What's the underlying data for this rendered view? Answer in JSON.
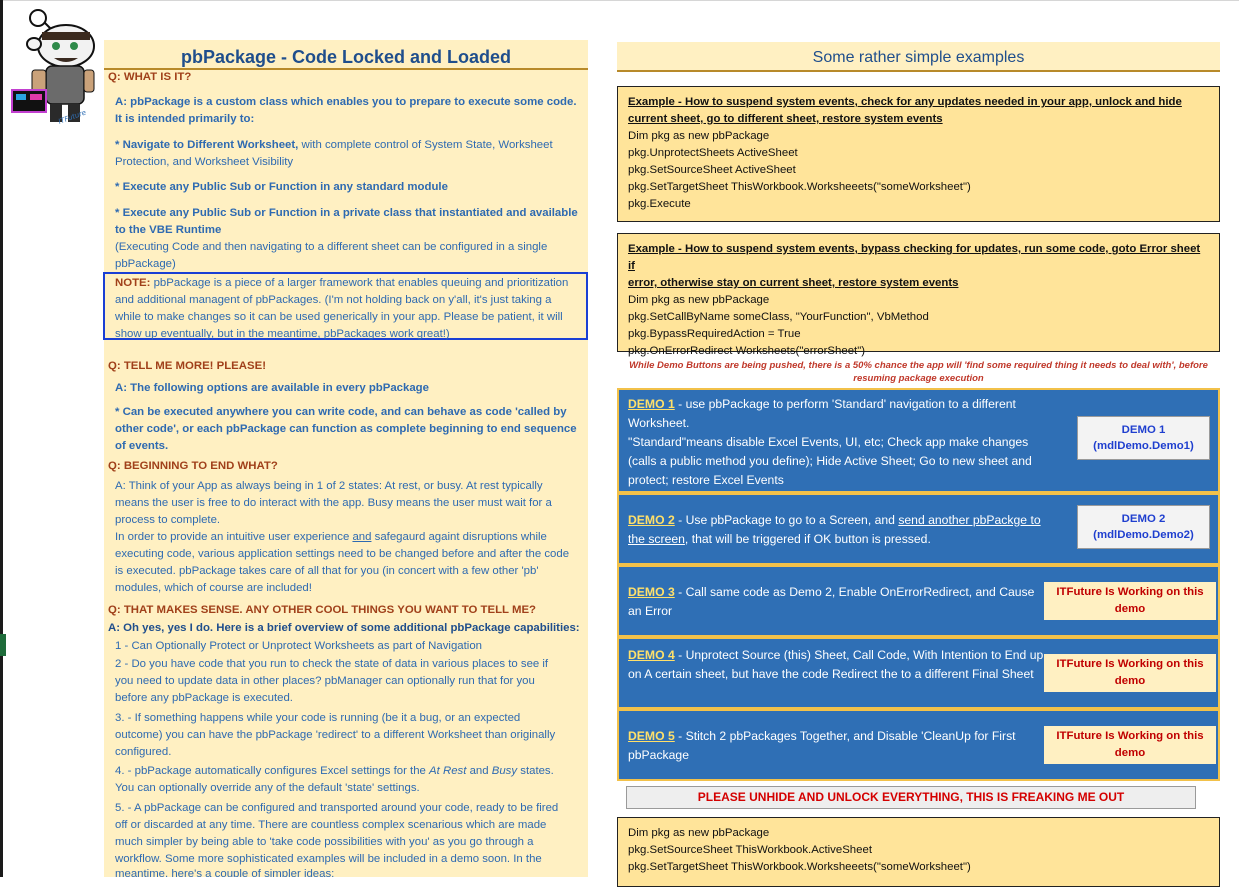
{
  "left": {
    "title": "pbPackage - Code Locked and Loaded",
    "q1": "Q: WHAT IS IT?",
    "a1_l1": "A: pbPackage is a custom class which enables you to  prepare to execute some code.",
    "a1_l2": "It is intended primarily to:",
    "nav_bold": "* Navigate to Different Worksheet,",
    "nav_rest": " with complete control of System State, Worksheet",
    "nav_l2": "Protection, and Worksheet Visibility",
    "exec_public": "* Execute any Public Sub or Function in any standard module",
    "exec_private_l1": "* Execute any Public Sub or Function in a private class that instantiated and available",
    "exec_private_l2": "to the VBE Runtime",
    "exec_note_l1": "(Executing Code and then navigating to a different sheet can be configured in a single",
    "exec_note_l2": "pbPackage)",
    "note_label": "NOTE:",
    "note_l1": " pbPackage is a piece of a larger framework that enables queuing and prioritization",
    "note_l2": "and additional managent of pbPackages. (I'm not holding back on y'all, it's just taking a",
    "note_l3": "while to make changes so it can be used generically in your app. Please be patient, it will",
    "note_l4": "show up eventually, but in the meantime, pbPackages work great!)",
    "q2": "Q: TELL ME MORE! PLEASE!",
    "a2_l1": "A: The following options are available in every pbPackage",
    "a2_b_l1": "* Can be executed anywhere you can write code, and can behave as code 'called by",
    "a2_b_l2": "other code', or each pbPackage can function as complete beginning to end sequence",
    "a2_b_l3": "of events.",
    "q3": "Q: BEGINNING TO END WHAT?",
    "a3_l1": "A: Think of your App as always being in 1 of 2 states:  At rest, or busy. At rest typically",
    "a3_l2": "means the user is free to do interact with the app.  Busy means the user must wait for a",
    "a3_l3": "process to complete.",
    "a3_l4a": "In order to provide an intuitive user experience ",
    "a3_l4u": "and",
    "a3_l4b": " safegaurd againt disruptions while",
    "a3_l5": "executing code, various application settings need to be changed before and after the code",
    "a3_l6": "is executed.  pbPackage takes care of all that for you (in concert with a few other 'pb'",
    "a3_l7": "modules, which of course are included!",
    "q4": "Q: THAT MAKES SENSE.  ANY OTHER COOL THINGS YOU WANT TO TELL ME?",
    "a4": "A: Oh yes, yes I do. Here is a brief overview of some additional pbPackage capabilities:",
    "c1": "1 - Can Optionally Protect or Unprotect Worksheets as part of Navigation",
    "c2_l1": "2 - Do you have code that you run to check the state of data in various places to see if",
    "c2_l2": "you need to update data in other places?  pbManager can optionally run that for you",
    "c2_l3": "before any pbPackage is executed.",
    "c3_l1": "3. - If something happens while your code is running (be it a bug, or an expected",
    "c3_l2": "outcome) you can have the pbPackage 'redirect' to a different Worksheet than originally",
    "c3_l3": "configured.",
    "c4_l1a": "4. - pbPackage automatically configures Excel settings for the ",
    "c4_l1i1": "At Rest",
    "c4_l1b": "  and ",
    "c4_l1i2": "Busy",
    "c4_l1c": "  states.",
    "c4_l2": "You can optionally override any of the default 'state' settings.",
    "c5_l1": "5. - A pbPackage can be configured and transported around your code, ready to be fired",
    "c5_l2": "off  or discarded at any time. There are countless complex scenarious which are made",
    "c5_l3": "much simpler by being able to 'take code possibilities with you' as you go through a",
    "c5_l4": "workflow. Some more sophisticated examples will be included in a demo soon. In the",
    "c5_l5": "meantime, here's a couple of simpler ideas:"
  },
  "right": {
    "title": "Some rather simple examples",
    "ex1_t1": "Example - How to suspend system events, check for any updates needed in your app, unlock and hide",
    "ex1_t2": "current sheet, go to different sheet, restore system events",
    "ex1_code": [
      "Dim pkg as new pbPackage",
      "pkg.UnprotectSheets ActiveSheet",
      "pkg.SetSourceSheet ActiveSheet",
      "pkg.SetTargetSheet ThisWorkbook.Worksheeets(\"someWorksheet\")",
      "pkg.Execute"
    ],
    "ex2_t1": "Example - How to  suspend system events, bypass checking for updates, run some code, goto Error sheet if",
    "ex2_t2": "error, otherwise stay on current sheet, restore system events",
    "ex2_code": [
      "Dim pkg as new pbPackage",
      "pkg.SetCallByName someClass, \"YourFunction\", VbMethod",
      "pkg.BypassRequiredAction = True",
      "pkg.OnErrorRedirect Worksheets(\"errorSheet\")"
    ],
    "warn_l1": "While Demo Buttons are being pushed, there is a 50% chance the app will 'find some required thing it needs to deal with', before",
    "warn_l2": "resuming package execution",
    "demo1_name": "DEMO 1",
    "demo1_text": " - use pbPackage to perform 'Standard' navigation to a different Worksheet.",
    "demo1_text2": "\"Standard\"means disable Excel Events, UI, etc; Check app make changes (calls a public method you define);  Hide Active Sheet; Go to new sheet and protect; restore Excel Events",
    "demo1_btn_l1": "DEMO 1",
    "demo1_btn_l2": "(mdlDemo.Demo1)",
    "demo2_name": "DEMO 2",
    "demo2_text_a": " - Use pbPackage to go to a Screen, and ",
    "demo2_text_u": "send another pbPackge to the screen",
    "demo2_text_b": ", that will be triggered if OK button is pressed.",
    "demo2_btn_l1": "DEMO 2",
    "demo2_btn_l2": "(mdlDemo.Demo2)",
    "demo3_name": "DEMO 3",
    "demo3_text": " - Call same code as Demo 2, Enable OnErrorRedirect, and Cause an Error",
    "demo4_name": "DEMO 4",
    "demo4_text": " - Unprotect Source (this) Sheet, Call Code, With Intention to End up on A certain sheet, but have the code Redirect the to a different Final Sheet",
    "demo5_name": "DEMO 5",
    "demo5_text": " - Stitch 2 pbPackages Together, and Disable 'CleanUp for First pbPackage",
    "working": "ITFuture Is Working on this demo",
    "unhide_btn": "PLEASE UNHIDE AND UNLOCK EVERYTHING, THIS IS FREAKING ME OUT",
    "ex3_code": [
      "Dim pkg as new pbPackage",
      "pkg.SetSourceSheet ThisWorkbook.ActiveSheet",
      "pkg.SetTargetSheet ThisWorkbook.Worksheeets(\"someWorksheet\")"
    ]
  },
  "mascot_label": "ITFuture",
  "colors": {
    "panel": "#fff0c2",
    "demo_blue": "#2f6fb5",
    "accent_text": "#2e6ab1",
    "question": "#a0401a"
  }
}
